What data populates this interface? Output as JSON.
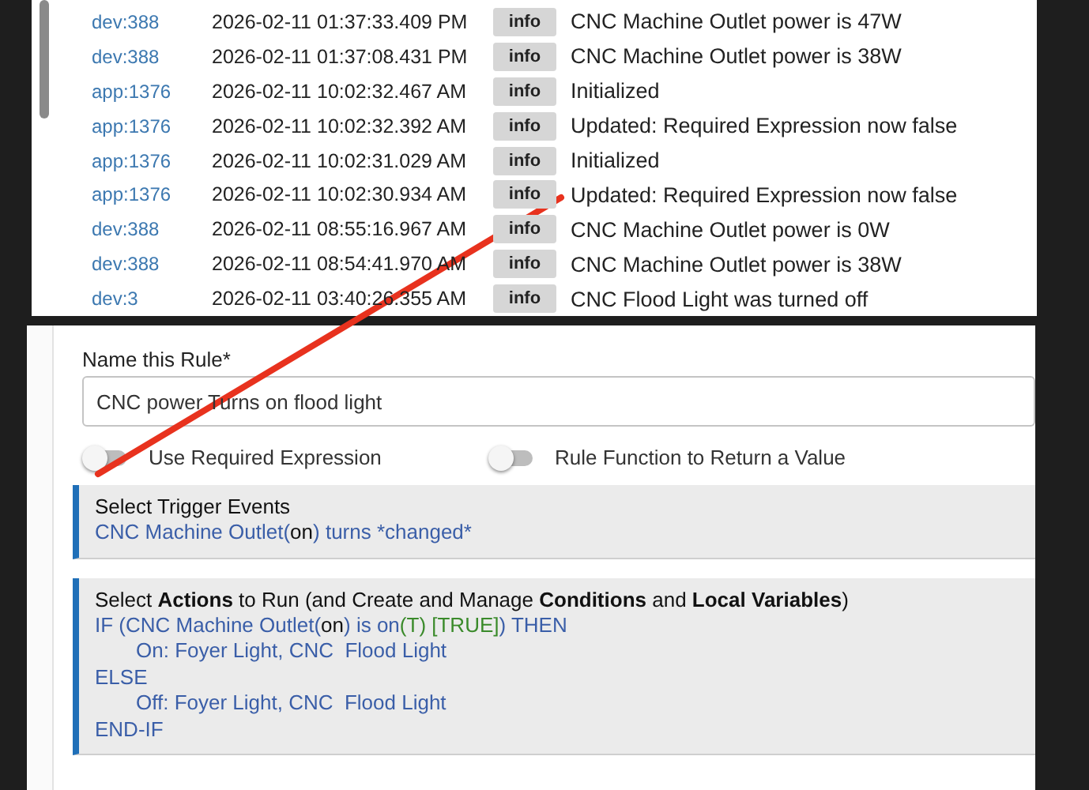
{
  "log": {
    "rows": [
      {
        "source": "dev:388",
        "time": "2026-02-11 01:37:33.409 PM",
        "level": "info",
        "message": "CNC Machine Outlet power is 47W"
      },
      {
        "source": "dev:388",
        "time": "2026-02-11 01:37:08.431 PM",
        "level": "info",
        "message": "CNC Machine Outlet power is 38W"
      },
      {
        "source": "app:1376",
        "time": "2026-02-11 10:02:32.467 AM",
        "level": "info",
        "message": "Initialized"
      },
      {
        "source": "app:1376",
        "time": "2026-02-11 10:02:32.392 AM",
        "level": "info",
        "message": "Updated: Required Expression now false"
      },
      {
        "source": "app:1376",
        "time": "2026-02-11 10:02:31.029 AM",
        "level": "info",
        "message": "Initialized"
      },
      {
        "source": "app:1376",
        "time": "2026-02-11 10:02:30.934 AM",
        "level": "info",
        "message": "Updated: Required Expression now false"
      },
      {
        "source": "dev:388",
        "time": "2026-02-11 08:55:16.967 AM",
        "level": "info",
        "message": "CNC Machine Outlet power is 0W"
      },
      {
        "source": "dev:388",
        "time": "2026-02-11 08:54:41.970 AM",
        "level": "info",
        "message": "CNC Machine Outlet power is 38W"
      },
      {
        "source": "dev:3",
        "time": "2026-02-11 03:40:26.355 AM",
        "level": "info",
        "message": "CNC Flood Light was turned off"
      }
    ]
  },
  "rule": {
    "name_label": "Name this Rule*",
    "name_value": "CNC power Turns on flood light",
    "toggles": [
      {
        "label": "Use Required Expression",
        "on": false
      },
      {
        "label": "Rule Function to Return a Value",
        "on": false
      }
    ],
    "sections": [
      {
        "title": "Select Trigger Events",
        "lines": [
          [
            {
              "kind": "link",
              "text": "CNC Machine Outlet("
            },
            {
              "kind": "plain",
              "text": "on"
            },
            {
              "kind": "link",
              "text": ") turns *changed*"
            }
          ]
        ]
      },
      {
        "title": "Select **Actions** to Run (and Create and Manage **Conditions** and **Local Variables**)",
        "lines": [
          [
            {
              "kind": "link",
              "text": "IF (CNC Machine Outlet("
            },
            {
              "kind": "plain",
              "text": "on"
            },
            {
              "kind": "link",
              "text": ") is on"
            },
            {
              "kind": "value",
              "text": "(T) [TRUE]"
            },
            {
              "kind": "link",
              "text": ") THEN"
            }
          ],
          [
            {
              "kind": "indent",
              "text": "On: Foyer Light, CNC  Flood Light"
            }
          ],
          [
            {
              "kind": "link",
              "text": "ELSE"
            }
          ],
          [
            {
              "kind": "indent",
              "text": "Off: Foyer Light, CNC  Flood Light"
            }
          ],
          [
            {
              "kind": "link",
              "text": "END-IF"
            }
          ]
        ]
      }
    ]
  },
  "annotation": {
    "kind": "line",
    "color": "#e8321e"
  }
}
